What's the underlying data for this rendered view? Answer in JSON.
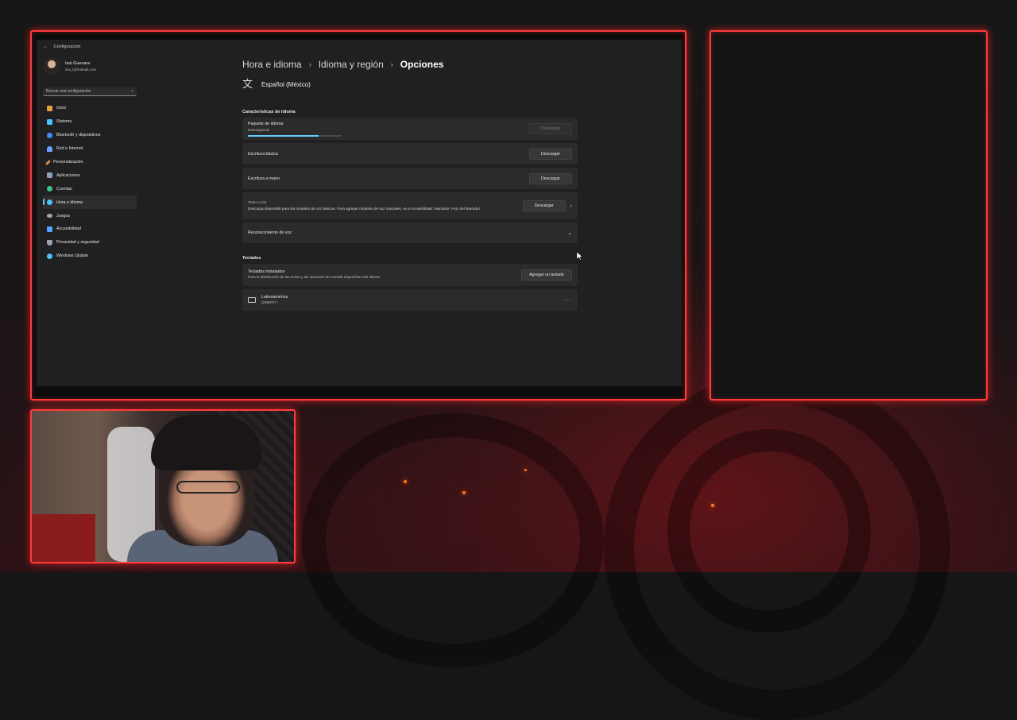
{
  "window": {
    "title": "Configuración"
  },
  "profile": {
    "name": "Isai Guevara",
    "email": "isai_l@hotmail.com"
  },
  "search": {
    "placeholder": "Buscar una configuración"
  },
  "sidebar": {
    "items": [
      {
        "label": "Inicio",
        "icon": "home-icon",
        "color": "#e8a33c"
      },
      {
        "label": "Sistema",
        "icon": "system-icon",
        "color": "#4cc2ff"
      },
      {
        "label": "Bluetooth y dispositivos",
        "icon": "bluetooth-icon",
        "color": "#3d8bff"
      },
      {
        "label": "Red e Internet",
        "icon": "wifi-icon",
        "color": "#6aa0ff"
      },
      {
        "label": "Personalización",
        "icon": "brush-icon",
        "color": "#d98a4f"
      },
      {
        "label": "Aplicaciones",
        "icon": "apps-icon",
        "color": "#8fa1b8"
      },
      {
        "label": "Cuentas",
        "icon": "account-icon",
        "color": "#3fc48a"
      },
      {
        "label": "Hora e idioma",
        "icon": "clock-globe-icon",
        "color": "#4cc2ff",
        "active": true
      },
      {
        "label": "Juegos",
        "icon": "gamepad-icon",
        "color": "#9aa4b1"
      },
      {
        "label": "Accesibilidad",
        "icon": "accessibility-icon",
        "color": "#4ca7ff"
      },
      {
        "label": "Privacidad y seguridad",
        "icon": "shield-icon",
        "color": "#9aa4b1"
      },
      {
        "label": "Windows Update",
        "icon": "update-icon",
        "color": "#4cc2ff"
      }
    ]
  },
  "breadcrumb": {
    "items": [
      "Hora e idioma",
      "Idioma y región"
    ],
    "current": "Opciones",
    "separator": "›"
  },
  "language": {
    "name": "Español (México)"
  },
  "features": {
    "title": "Características de idioma",
    "pack": {
      "label": "Paquete de idioma",
      "status": "Descargando",
      "progress": 0.75,
      "button": "Descargar"
    },
    "basic": {
      "label": "Escritura básica",
      "button": "Descargar"
    },
    "handwriting": {
      "label": "Escritura a mano",
      "button": "Descargar"
    },
    "tts": {
      "label": "Texto a voz",
      "description": "Descarga disponible para los modelos de voz básicos. Para agregar modelos de voz naturales, ve a Accesibilidad >Narrador >Voz del Narrador",
      "button": "Descargar"
    },
    "speech": {
      "label": "Reconocimiento de voz"
    }
  },
  "keyboards": {
    "title": "Teclados",
    "installed": {
      "label": "Teclados instalados",
      "description": "Para la distribución de las teclas y las opciones de entrada específicas del idioma",
      "button": "Agregar un teclado"
    },
    "items": [
      {
        "name": "Latinoamérica",
        "layout": "QWERTY"
      }
    ]
  },
  "colors": {
    "accent": "#60cdff",
    "frame": "#ff3b3b"
  }
}
